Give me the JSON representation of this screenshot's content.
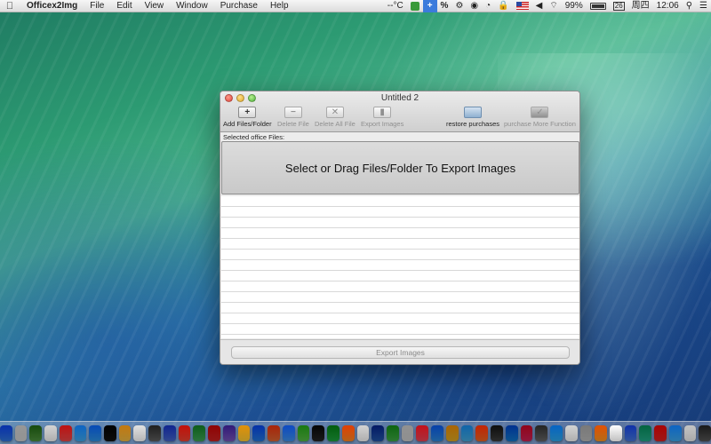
{
  "menubar": {
    "app_name": "Officex2Img",
    "menus": [
      "File",
      "Edit",
      "View",
      "Window",
      "Purchase",
      "Help"
    ],
    "status": {
      "temperature": "--°C",
      "plus": "+",
      "percent": "%",
      "battery": "99%",
      "date_box": "26",
      "weekday": "周四",
      "time": "12:06"
    }
  },
  "window": {
    "title": "Untitled 2",
    "toolbar": {
      "add": {
        "icon": "+",
        "label": "Add Files/Folder"
      },
      "delete": {
        "icon": "−",
        "label": "Delete File"
      },
      "delete_all": {
        "icon": "✕",
        "label": "Delete All File"
      },
      "export": {
        "icon": "▮",
        "label": "Export Images"
      },
      "restore": {
        "icon": "",
        "label": "restore purchases"
      },
      "purchase": {
        "icon": "✓",
        "label": "purchase More Function"
      }
    },
    "selected_label": "Selected office Files:",
    "dropzone_text": "Select or Drag Files/Folder To Export Images",
    "export_button": "Export Images"
  },
  "colors": {
    "accent": "#3b7bdc",
    "window_bg": "#ececec"
  },
  "dock": {
    "icon_colors": [
      "#2d6fd1",
      "#c4c4c4",
      "#4a8a3a",
      "#e8e8e8",
      "#d44",
      "#3aa0e0",
      "#2a8ad8",
      "#111",
      "#e0b040",
      "#f0f0f0",
      "#5a5a5a",
      "#4060c0",
      "#e04030",
      "#3a9a50",
      "#c02020",
      "#7050b0",
      "#f0c030",
      "#2070d0",
      "#d06030",
      "#3a8ae0",
      "#50b040",
      "#222",
      "#1b9a3a",
      "#f08020",
      "#e8e8e8",
      "#2050a0",
      "#3aa040",
      "#c0c0c0",
      "#e04050",
      "#2a80d0",
      "#d0a020",
      "#40a0d0",
      "#e06020",
      "#3a3a3a",
      "#1070c0",
      "#c02050",
      "#606060",
      "#2aa0e0",
      "#e8e8e8",
      "#b0b0b0",
      "#f09020",
      "#ffffff",
      "#4070d0",
      "#20a080",
      "#d02020",
      "#3aa0e0",
      "#e0e0e0",
      "#505050"
    ]
  }
}
